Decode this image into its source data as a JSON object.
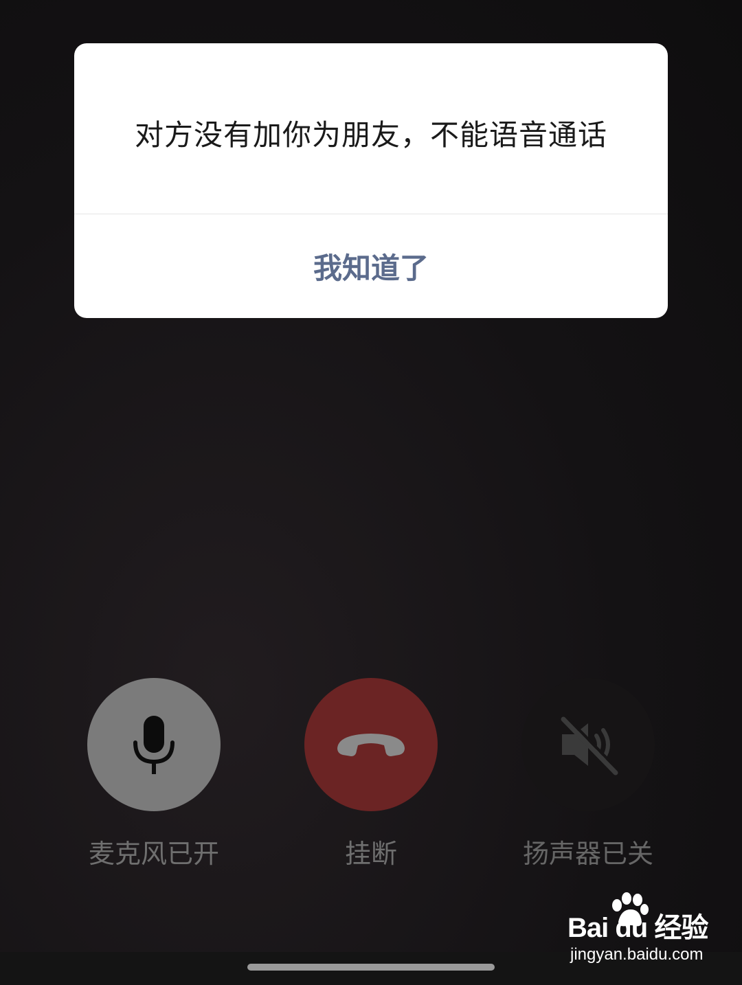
{
  "dialog": {
    "message": "对方没有加你为朋友，不能语音通话",
    "button_label": "我知道了"
  },
  "controls": {
    "microphone": {
      "label": "麦克风已开",
      "icon": "microphone-icon",
      "color": "#7b7b7b"
    },
    "hangup": {
      "label": "挂断",
      "icon": "phone-hangup-icon",
      "color": "#6b2424"
    },
    "speaker": {
      "label": "扬声器已关",
      "icon": "speaker-muted-icon",
      "color": "#161415"
    }
  },
  "colors": {
    "dialog_button_text": "#5b6b8c",
    "background": "#141214"
  },
  "watermark": {
    "brand": "Bai du 经验",
    "url": "jingyan.baidu.com"
  }
}
